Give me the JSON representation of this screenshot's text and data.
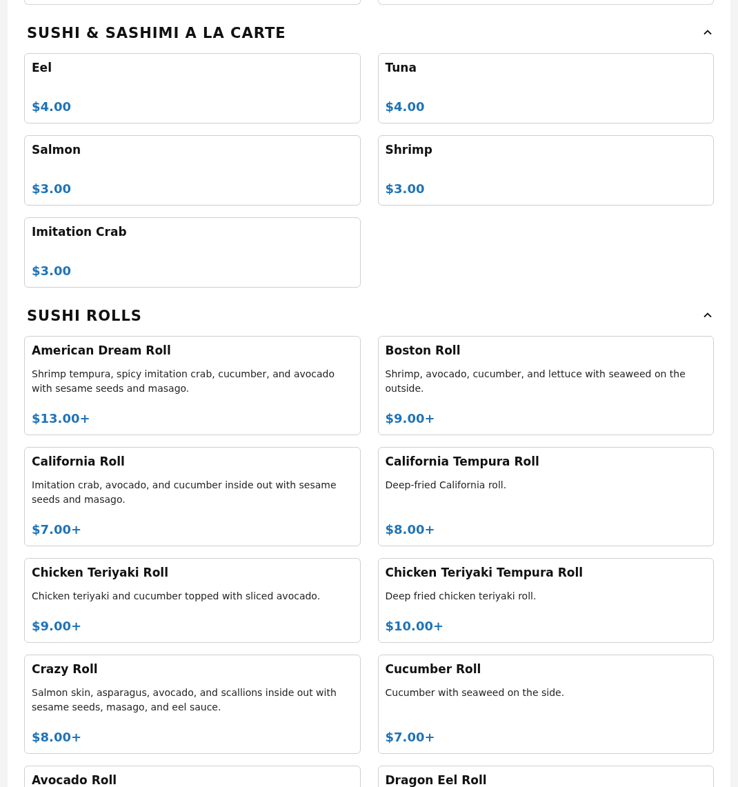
{
  "sections": [
    {
      "title": "SUSHI & SASHIMI A LA CARTE",
      "expanded": true,
      "items": [
        {
          "name": "Eel",
          "price": "$4.00"
        },
        {
          "name": "Tuna",
          "price": "$4.00"
        },
        {
          "name": "Salmon",
          "price": "$3.00"
        },
        {
          "name": "Shrimp",
          "price": "$3.00"
        },
        {
          "name": "Imitation Crab",
          "price": "$3.00"
        }
      ]
    },
    {
      "title": "SUSHI ROLLS",
      "expanded": true,
      "items": [
        {
          "name": "American Dream Roll",
          "description": "Shrimp tempura, spicy imitation crab, cucumber, and avocado with sesame seeds and masago.",
          "price": "$13.00+"
        },
        {
          "name": "Boston Roll",
          "description": "Shrimp, avocado, cucumber, and lettuce with seaweed on the outside.",
          "price": "$9.00+"
        },
        {
          "name": "California Roll",
          "description": "Imitation crab, avocado, and cucumber inside out with sesame seeds and masago.",
          "price": "$7.00+"
        },
        {
          "name": "California Tempura Roll",
          "description": "Deep-fried California roll.",
          "price": "$8.00+"
        },
        {
          "name": "Chicken Teriyaki Roll",
          "description": "Chicken teriyaki and cucumber topped with sliced avocado.",
          "price": "$9.00+"
        },
        {
          "name": "Chicken Teriyaki Tempura Roll",
          "description": "Deep fried chicken teriyaki roll.",
          "price": "$10.00+"
        },
        {
          "name": "Crazy Roll",
          "description": "Salmon skin, asparagus, avocado, and scallions inside out with sesame seeds, masago, and eel sauce.",
          "price": "$8.00+"
        },
        {
          "name": "Cucumber Roll",
          "description": "Cucumber with seaweed on the side.",
          "price": "$7.00+"
        },
        {
          "name": "Avocado Roll"
        },
        {
          "name": "Dragon Eel Roll"
        }
      ]
    }
  ]
}
